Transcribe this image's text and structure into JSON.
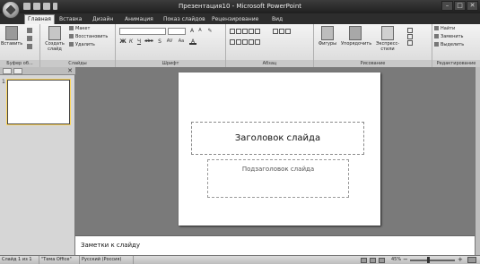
{
  "window": {
    "title": "Презентация10 - Microsoft PowerPoint"
  },
  "quick_access": [
    {
      "icon": "save-icon"
    },
    {
      "icon": "undo-icon"
    },
    {
      "icon": "redo-icon"
    }
  ],
  "tabs": [
    {
      "label": "Главная",
      "active": true
    },
    {
      "label": "Вставка"
    },
    {
      "label": "Дизайн"
    },
    {
      "label": "Анимация"
    },
    {
      "label": "Показ слайдов"
    },
    {
      "label": "Рецензирование"
    },
    {
      "label": "Вид"
    }
  ],
  "ribbon": {
    "clipboard": {
      "label": "Буфер об...",
      "paste": "Вставить"
    },
    "slides": {
      "label": "Слайды",
      "new_slide": "Создать слайд",
      "layout": "Макет",
      "reset": "Восстановить",
      "delete": "Удалить"
    },
    "font": {
      "label": "Шрифт",
      "font_name": "",
      "font_size": "",
      "bold": "Ж",
      "italic": "К",
      "underline": "Ч",
      "strike": "abe",
      "shadow": "S",
      "spacing": "AV",
      "case": "Aa",
      "color": "A",
      "grow": "A",
      "shrink": "A"
    },
    "paragraph": {
      "label": "Абзац"
    },
    "drawing": {
      "label": "Рисование",
      "shapes": "Фигуры",
      "arrange": "Упорядочить",
      "quick_styles": "Экспресс-стили"
    },
    "editing": {
      "label": "Редактирование",
      "find": "Найти",
      "replace": "Заменить",
      "select": "Выделить"
    }
  },
  "outline": {
    "slide_number": "1"
  },
  "slide": {
    "title_placeholder": "Заголовок слайда",
    "subtitle_placeholder": "Подзаголовок слайда"
  },
  "notes": {
    "placeholder": "Заметки к слайду"
  },
  "status": {
    "slide_info": "Слайд 1 из 1",
    "theme": "\"Тема Office\"",
    "language": "Русский (Россия)",
    "zoom": "45%",
    "zoom_value": 45
  }
}
